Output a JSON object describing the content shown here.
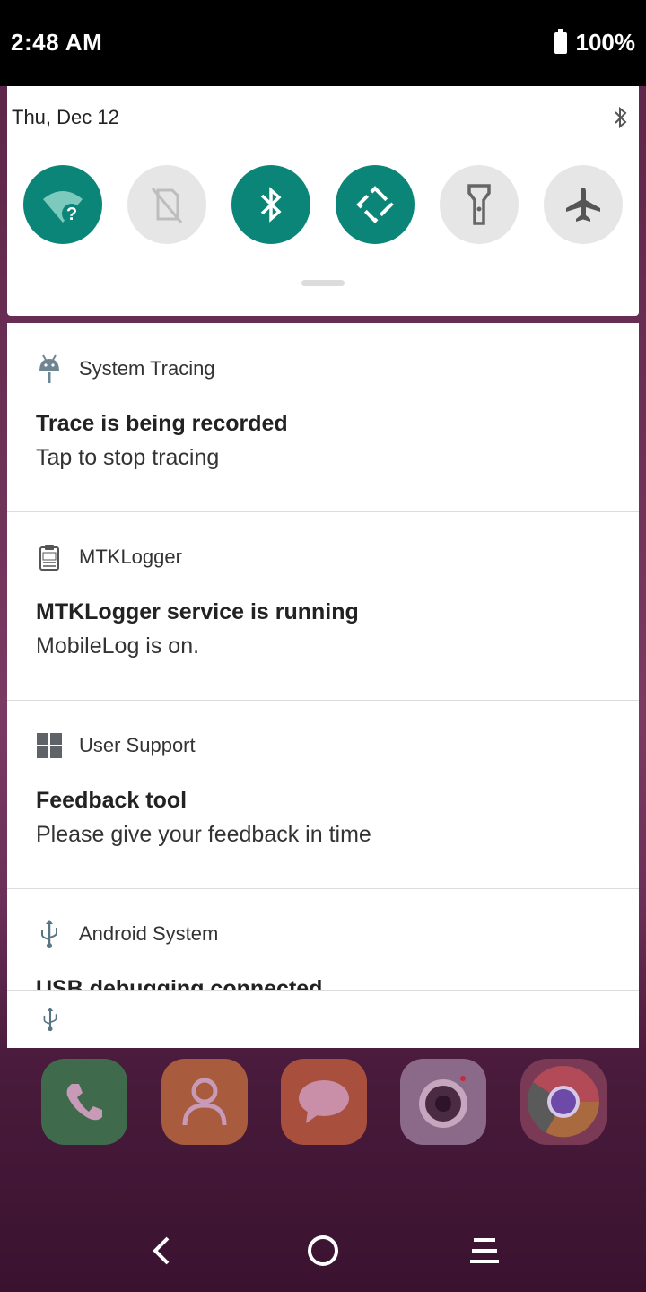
{
  "status_bar": {
    "time": "2:48 AM",
    "battery": "100%"
  },
  "quick_settings": {
    "date": "Thu, Dec 12",
    "tiles": [
      {
        "name": "wifi",
        "state": "on"
      },
      {
        "name": "mobile-data",
        "state": "off"
      },
      {
        "name": "bluetooth",
        "state": "on"
      },
      {
        "name": "auto-rotate",
        "state": "on"
      },
      {
        "name": "flashlight",
        "state": "off"
      },
      {
        "name": "airplane-mode",
        "state": "off"
      }
    ],
    "accent_color": "#0b8577"
  },
  "notifications": [
    {
      "app": "System Tracing",
      "icon": "android-icon",
      "title": "Trace is being recorded",
      "text": "Tap to stop tracing"
    },
    {
      "app": "MTKLogger",
      "icon": "log-clipboard-icon",
      "title": "MTKLogger service is running",
      "text": "MobileLog is on."
    },
    {
      "app": "User Support",
      "icon": "grid-icon",
      "title": "Feedback tool",
      "text": "Please give your feedback in time"
    },
    {
      "app": "Android System",
      "icon": "usb-icon",
      "title": "USB debugging connected",
      "text": ""
    }
  ],
  "dock_apps": [
    "Phone",
    "Contacts",
    "Messages",
    "Camera",
    "Chrome"
  ]
}
